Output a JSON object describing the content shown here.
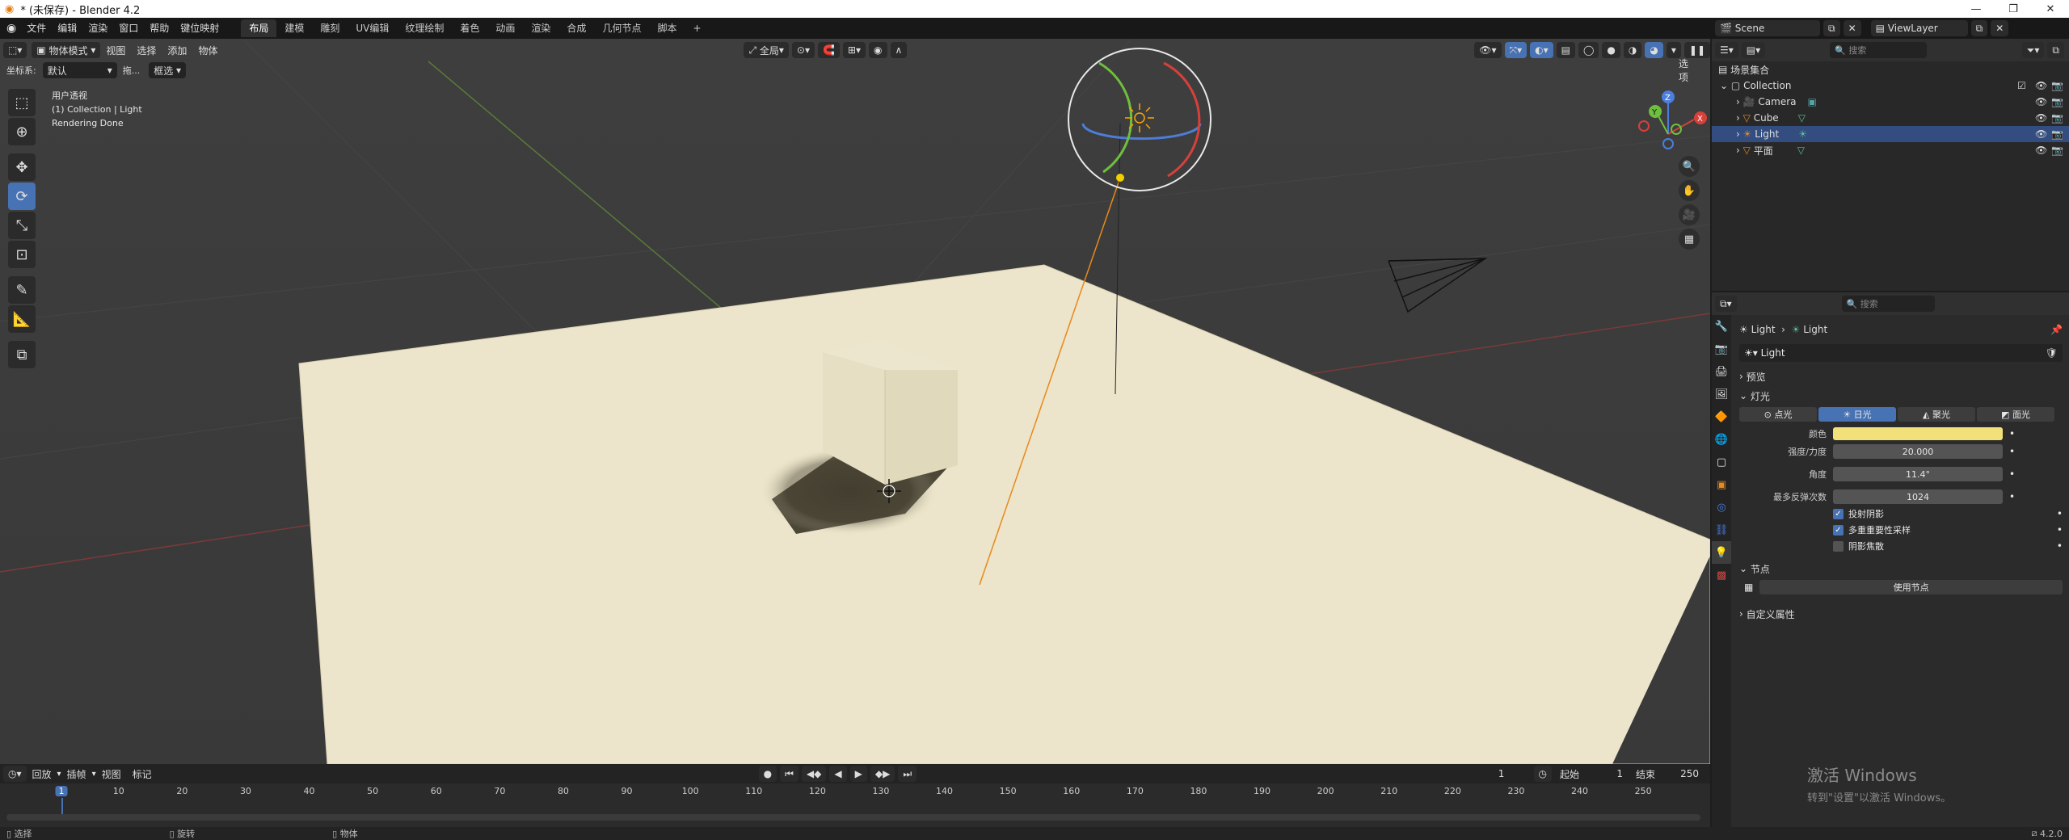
{
  "window": {
    "title": "* (未保存) - Blender 4.2"
  },
  "menu": [
    "文件",
    "编辑",
    "渲染",
    "窗口",
    "帮助",
    "键位映射"
  ],
  "workspaces": [
    "布局",
    "建模",
    "雕刻",
    "UV编辑",
    "纹理绘制",
    "着色",
    "动画",
    "渲染",
    "合成",
    "几何节点",
    "脚本"
  ],
  "viewport": {
    "mode": "物体模式",
    "menus": [
      "视图",
      "选择",
      "添加",
      "物体"
    ],
    "transform_orient_label": "坐标系:",
    "transform_orient": "默认",
    "drag_label": "拖...",
    "select_box": "框选",
    "pivot": "全局",
    "options": "选项",
    "overlay_text": [
      "用户透视",
      "(1) Collection | Light",
      "Rendering Done"
    ]
  },
  "timeline": {
    "menus": [
      "回放",
      "插帧",
      "视图",
      "标记"
    ],
    "current_frame": "1",
    "start_label": "起始",
    "start": "1",
    "end_label": "结束",
    "end": "250",
    "ruler": [
      "1",
      "10",
      "20",
      "30",
      "40",
      "50",
      "60",
      "70",
      "80",
      "90",
      "100",
      "110",
      "120",
      "130",
      "140",
      "150",
      "160",
      "170",
      "180",
      "190",
      "200",
      "210",
      "220",
      "230",
      "240",
      "250"
    ]
  },
  "status": {
    "select": "选择",
    "rotate": "旋转",
    "object": "物体",
    "version": "4.2.0"
  },
  "outliner": {
    "scene": "Scene",
    "view_layer": "ViewLayer",
    "search": "搜索",
    "root": "场景集合",
    "collection": "Collection",
    "items": [
      {
        "label": "Camera"
      },
      {
        "label": "Cube"
      },
      {
        "label": "Light"
      },
      {
        "label": "平面"
      }
    ]
  },
  "properties": {
    "search": "搜索",
    "breadcrumb": [
      "Light",
      "Light"
    ],
    "datablock": "Light",
    "preview": "预览",
    "light_section": "灯光",
    "light_types": [
      "点光",
      "日光",
      "聚光",
      "面光"
    ],
    "color_label": "颜色",
    "color": "#f2e07a",
    "strength_label": "强度/力度",
    "strength": "20.000",
    "angle_label": "角度",
    "angle": "11.4°",
    "bounces_label": "最多反弹次数",
    "bounces": "1024",
    "cast_shadow": "投射阴影",
    "mis": "多重重要性采样",
    "caustics": "阴影焦散",
    "nodes_section": "节点",
    "use_nodes": "使用节点",
    "custom_props": "自定义属性"
  },
  "watermark": {
    "line1": "激活 Windows",
    "line2": "转到\"设置\"以激活 Windows。"
  }
}
